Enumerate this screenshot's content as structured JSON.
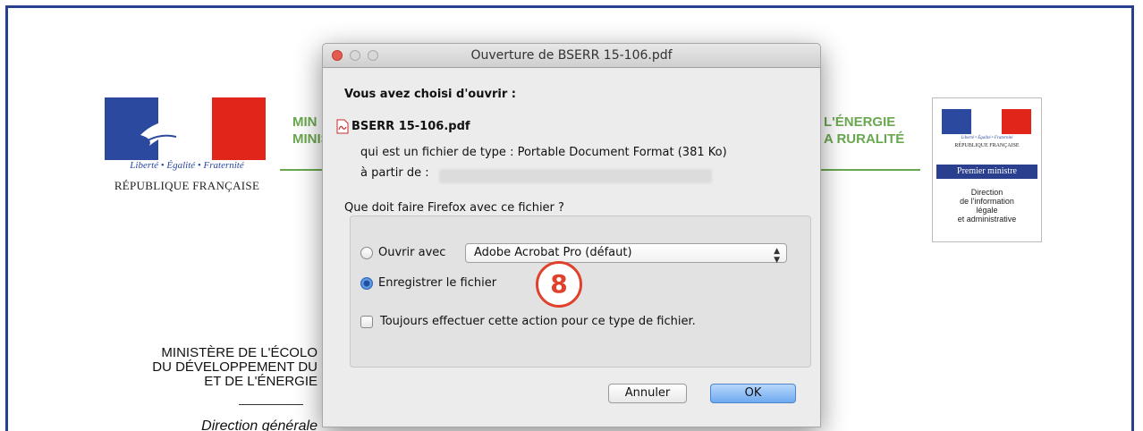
{
  "background_doc": {
    "rf_motto": "Liberté • Égalité • Fraternité",
    "rf_name": "RÉPUBLIQUE FRANÇAISE",
    "ministry_left_1": "MIN",
    "ministry_left_2": "MINIS",
    "ministry_right_1": "L'ÉNERGIE",
    "ministry_right_2": "A RURALITÉ",
    "pm_motto": "Liberté • Égalité • Fraternité",
    "pm_rf": "RÉPUBLIQUE FRANÇAISE",
    "pm_band": "Premier ministre",
    "pm_dila_1": "Direction",
    "pm_dila_2": "de l'information",
    "pm_dila_3": "légale",
    "pm_dila_4": "et administrative",
    "ministere_1": "MINISTÈRE DE L'ÉCOLO",
    "ministere_2": "DU DÉVELOPPEMENT DU",
    "ministere_3": "ET DE L'ÉNERGIE",
    "direction": "Direction générale"
  },
  "dialog": {
    "title": "Ouverture de BSERR 15-106.pdf",
    "chosen_label": "Vous avez choisi d'ouvrir :",
    "file_name": "BSERR 15-106.pdf",
    "file_type_line": "qui est un fichier de type : Portable Document Format (381 Ko)",
    "from_label": "à partir de :",
    "question": "Que doit faire Firefox avec ce fichier ?",
    "open_with_label": "Ouvrir avec",
    "open_with_value": "Adobe Acrobat Pro (défaut)",
    "save_label": "Enregistrer le fichier",
    "always_label": "Toujours effectuer cette action pour ce type de fichier.",
    "cancel_label": "Annuler",
    "ok_label": "OK",
    "selected_option": "save"
  },
  "step_badge": "8",
  "colors": {
    "frame": "#2b3f8f",
    "green": "#6aa84f",
    "badge": "#e0412d",
    "ok_button": "#6eaaf1"
  }
}
